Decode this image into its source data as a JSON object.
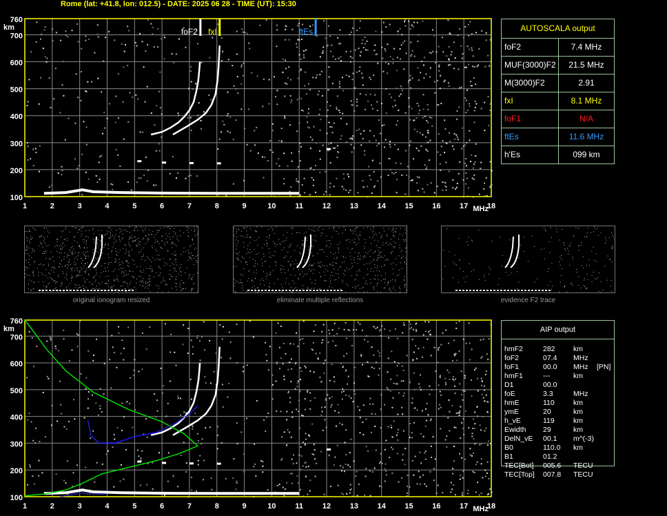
{
  "header": {
    "title": "Rome (lat: +41.8, lon: 012.5) - DATE: 2025 06 28 - TIME (UT): 15:30"
  },
  "colors": {
    "frame": "#ffff00",
    "grid": "#8a8a8a",
    "trace": "#ffffff",
    "panel_border": "#9ec29e",
    "yellow": "#ffff00",
    "red": "#ff2020",
    "blue": "#3399ff",
    "green": "#00dd00",
    "profile_blue": "#2222ff"
  },
  "chart_data": [
    {
      "type": "scatter",
      "name": "main ionogram",
      "x_ticks": [
        "1",
        "2",
        "3",
        "4",
        "5",
        "6",
        "7",
        "8",
        "9",
        "10",
        "11",
        "12",
        "13",
        "14",
        "15",
        "16",
        "17",
        "18"
      ],
      "y_ticks": [
        "100",
        "200",
        "300",
        "400",
        "500",
        "600",
        "700",
        "760"
      ],
      "xunit": "MHz",
      "yunit": "km",
      "xlim": [
        1,
        18
      ],
      "ylim": [
        100,
        760
      ],
      "grid": true,
      "markers": [
        {
          "label": "foF2",
          "freq": 7.4,
          "color": "#ffffff"
        },
        {
          "label": "fxI",
          "freq": 8.1,
          "color": "#ffff00"
        },
        {
          "label": "ftEs",
          "freq": 11.6,
          "color": "#3399ff"
        }
      ],
      "traces": {
        "o_mode": [
          [
            5.6,
            330
          ],
          [
            6.0,
            340
          ],
          [
            6.3,
            355
          ],
          [
            6.6,
            375
          ],
          [
            6.8,
            395
          ],
          [
            7.0,
            420
          ],
          [
            7.15,
            450
          ],
          [
            7.25,
            490
          ],
          [
            7.32,
            530
          ],
          [
            7.36,
            570
          ],
          [
            7.38,
            600
          ]
        ],
        "x_mode": [
          [
            6.4,
            330
          ],
          [
            6.9,
            360
          ],
          [
            7.3,
            385
          ],
          [
            7.6,
            410
          ],
          [
            7.8,
            440
          ],
          [
            7.95,
            480
          ],
          [
            8.02,
            530
          ],
          [
            8.06,
            580
          ],
          [
            8.08,
            620
          ],
          [
            8.1,
            660
          ]
        ],
        "e_layer": [
          [
            1.7,
            112
          ],
          [
            2.5,
            115
          ],
          [
            3.1,
            125
          ],
          [
            3.5,
            118
          ],
          [
            4.5,
            115
          ],
          [
            6,
            113
          ],
          [
            8,
            112
          ],
          [
            9.5,
            112
          ],
          [
            11,
            112
          ]
        ],
        "sporadic": [
          [
            5.1,
            230
          ],
          [
            6.0,
            225
          ],
          [
            7.0,
            223
          ],
          [
            8.0,
            222
          ],
          [
            12.0,
            275
          ]
        ]
      }
    },
    {
      "type": "scatter",
      "name": "AIP ionogram",
      "x_ticks": [
        "1",
        "2",
        "3",
        "4",
        "5",
        "6",
        "7",
        "8",
        "9",
        "10",
        "11",
        "12",
        "13",
        "14",
        "15",
        "16",
        "17",
        "18"
      ],
      "y_ticks": [
        "100",
        "200",
        "300",
        "400",
        "500",
        "600",
        "700",
        "760"
      ],
      "xunit": "MHz",
      "yunit": "km",
      "xlim": [
        1,
        18
      ],
      "ylim": [
        100,
        760
      ],
      "grid": true,
      "profile_green": [
        [
          1.0,
          760
        ],
        [
          1.3,
          720
        ],
        [
          1.8,
          650
        ],
        [
          2.5,
          570
        ],
        [
          3.5,
          490
        ],
        [
          4.8,
          425
        ],
        [
          6.0,
          380
        ],
        [
          6.8,
          335
        ],
        [
          7.3,
          290
        ],
        [
          6.6,
          260
        ],
        [
          5.8,
          235
        ],
        [
          4.8,
          210
        ],
        [
          3.8,
          185
        ],
        [
          3.1,
          150
        ],
        [
          2.5,
          125
        ],
        [
          1.7,
          110
        ],
        [
          1.0,
          103
        ]
      ],
      "profile_blue": [
        [
          2.3,
          100
        ],
        [
          3.1,
          115
        ],
        [
          3.3,
          110
        ],
        [
          3.9,
          110
        ]
      ],
      "profile_blue_upper": [
        [
          3.3,
          385
        ],
        [
          3.4,
          330
        ],
        [
          3.7,
          300
        ],
        [
          4.3,
          300
        ],
        [
          5.0,
          325
        ],
        [
          5.8,
          340
        ],
        [
          6.5,
          375
        ],
        [
          7.0,
          410
        ],
        [
          7.3,
          440
        ]
      ]
    }
  ],
  "thumbnails": [
    {
      "caption": "original ionogram resized"
    },
    {
      "caption": "eliminate multiple reflections"
    },
    {
      "caption": "evidence F2 trace"
    }
  ],
  "autoscala": {
    "title": "AUTOSCALA output",
    "rows": [
      {
        "label": "foF2",
        "value": "7.4 MHz",
        "color": "#ffffff"
      },
      {
        "label": "MUF(3000)F2",
        "value": "21.5 MHz",
        "color": "#ffffff"
      },
      {
        "label": "M(3000)F2",
        "value": "2.91",
        "color": "#ffffff"
      },
      {
        "label": "fxI",
        "value": "8.1 MHz",
        "color": "#ffff00"
      },
      {
        "label": "foF1",
        "value": "N/A",
        "color": "#ff2020"
      },
      {
        "label": "ftEs",
        "value": "11.6 MHz",
        "color": "#3399ff"
      },
      {
        "label": "h'Es",
        "value": "099    km",
        "color": "#ffffff"
      }
    ]
  },
  "aip": {
    "title": "AIP output",
    "rows": [
      {
        "label": "hmF2",
        "value": "282",
        "unit": "km",
        "extra": ""
      },
      {
        "label": "foF2",
        "value": "07.4",
        "unit": "MHz",
        "extra": ""
      },
      {
        "label": "foF1",
        "value": "00.0",
        "unit": "MHz",
        "extra": "[PN]"
      },
      {
        "label": "hmF1",
        "value": "---",
        "unit": "km",
        "extra": ""
      },
      {
        "label": "D1",
        "value": "00.0",
        "unit": "",
        "extra": ""
      },
      {
        "label": "foE",
        "value": "3.3",
        "unit": "MHz",
        "extra": ""
      },
      {
        "label": "hmE",
        "value": "110",
        "unit": "km",
        "extra": ""
      },
      {
        "label": "ymE",
        "value": "20",
        "unit": "km",
        "extra": ""
      },
      {
        "label": "h_vE",
        "value": "119",
        "unit": "km",
        "extra": ""
      },
      {
        "label": "Ewidth",
        "value": "29",
        "unit": "km",
        "extra": ""
      },
      {
        "label": "DelN_vE",
        "value": "00.1",
        "unit": "m^(-3)",
        "extra": ""
      },
      {
        "label": "B0",
        "value": "110.0",
        "unit": "km",
        "extra": ""
      },
      {
        "label": "B1",
        "value": "01.2",
        "unit": "",
        "extra": ""
      },
      {
        "label": "TEC[Bot]",
        "value": "005.6",
        "unit": "TECU",
        "extra": ""
      },
      {
        "label": "TEC[Top]",
        "value": "007.8",
        "unit": "TECU",
        "extra": ""
      }
    ]
  }
}
